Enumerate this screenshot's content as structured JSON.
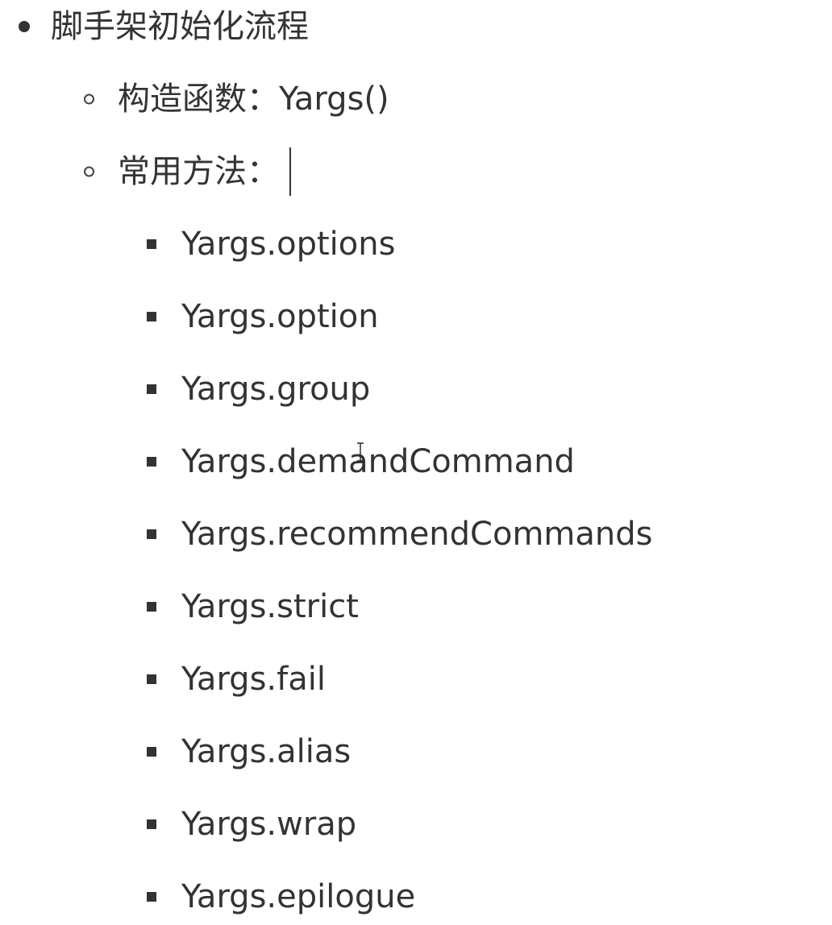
{
  "outline": {
    "top": {
      "label": "脚手架初始化流程"
    },
    "children": [
      {
        "label": "构造函数：Yargs()"
      },
      {
        "label": "常用方法："
      }
    ],
    "methods": [
      "Yargs.options",
      "Yargs.option",
      "Yargs.group",
      "Yargs.demandCommand",
      "Yargs.recommendCommands",
      "Yargs.strict",
      "Yargs.fail",
      "Yargs.alias",
      "Yargs.wrap",
      "Yargs.epilogue"
    ]
  },
  "icons": {
    "level1_bullet": "filled-disc-bullet",
    "level2_bullet": "hollow-circle-bullet",
    "level3_bullet": "filled-square-bullet",
    "text_cursor": "text-caret",
    "mouse_pointer": "ibeam-cursor-icon"
  },
  "colors": {
    "text": "#333333",
    "background": "#ffffff"
  }
}
